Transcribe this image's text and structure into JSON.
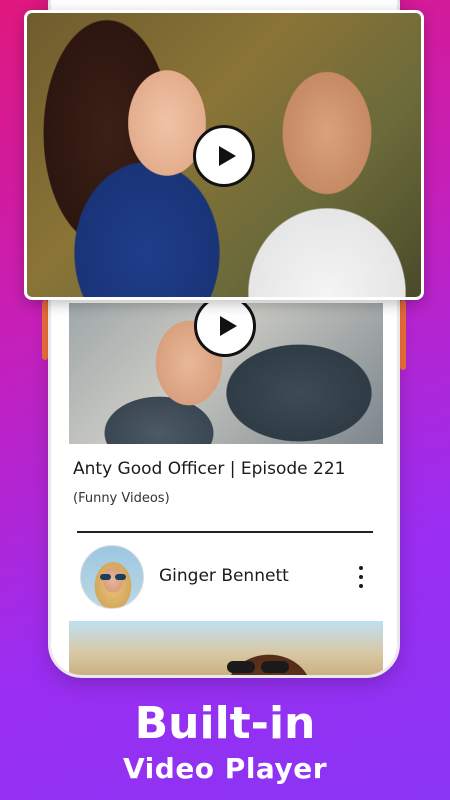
{
  "promo": {
    "headline": "Built-in",
    "subline": "Video Player"
  },
  "player": {
    "play_icon": "play-icon"
  },
  "feed": {
    "video": {
      "title": "Anty Good Officer | Episode 221",
      "category": "(Funny Videos)",
      "play_icon": "play-icon"
    },
    "next_post": {
      "author": "Ginger Bennett",
      "menu_icon": "more-vertical-icon"
    }
  },
  "colors": {
    "background_start": "#e0187e",
    "background_end": "#8a35f5",
    "card": "#ffffff",
    "text": "#1b1b1b"
  }
}
